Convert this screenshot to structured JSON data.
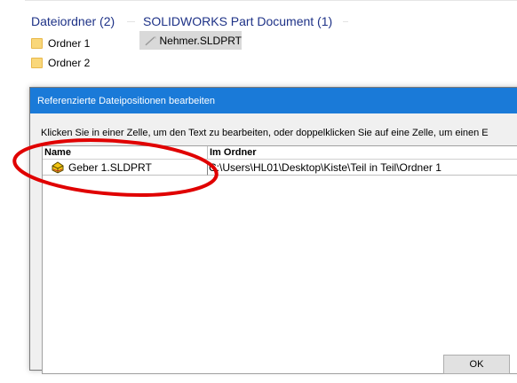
{
  "explorer": {
    "groups": [
      {
        "label": "Dateiordner (2)"
      },
      {
        "label": "SOLIDWORKS Part Document (1)"
      }
    ],
    "folders": [
      {
        "name": "Ordner 1",
        "icon": "folder-icon"
      },
      {
        "name": "Ordner 2",
        "icon": "folder-icon"
      }
    ],
    "files": [
      {
        "name": "Nehmer.SLDPRT",
        "icon": "solidworks-part-icon",
        "selected": true
      }
    ]
  },
  "dialog": {
    "title": "Referenzierte Dateipositionen bearbeiten",
    "instruction": "Klicken Sie in einer Zelle, um den Text zu bearbeiten, oder doppelklicken Sie auf eine Zelle, um einen E",
    "table": {
      "columns": [
        "Name",
        "Im Ordner"
      ],
      "rows": [
        {
          "name": "Geber 1.SLDPRT",
          "folder": "C:\\Users\\HL01\\Desktop\\Kiste\\Teil in Teil\\Ordner 1",
          "icon": "solidworks-part-icon"
        }
      ]
    },
    "ok_label": "OK"
  },
  "colors": {
    "group_header": "#1e3287",
    "title_bar": "#1a7ad8",
    "annotation": "#e00000",
    "folder": "#f9d77a"
  }
}
